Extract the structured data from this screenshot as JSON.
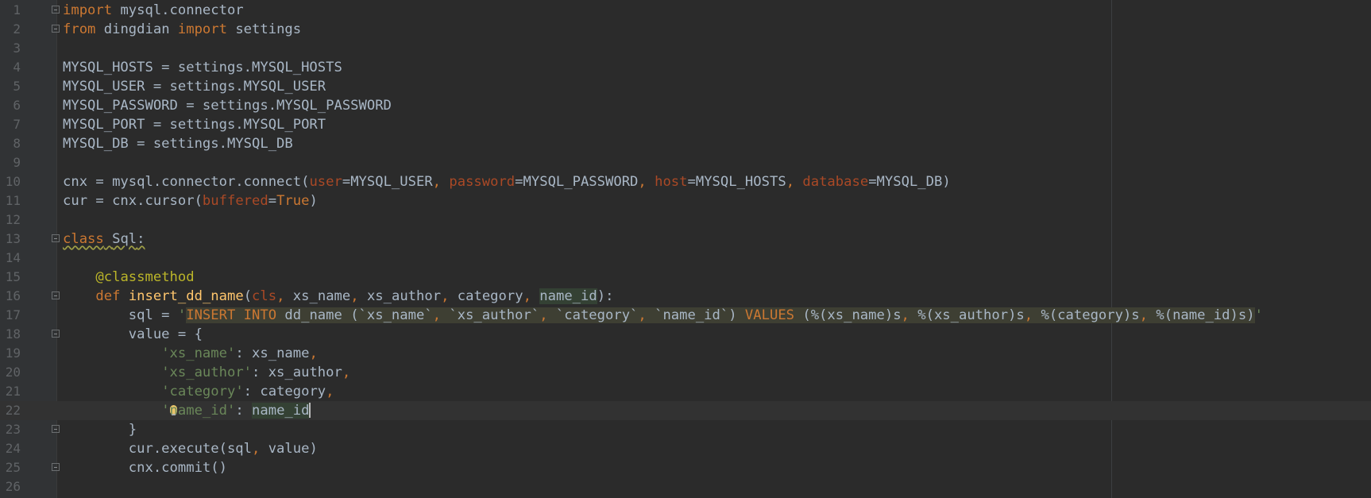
{
  "editor": {
    "lines": [
      {
        "n": "1",
        "tokens": [
          "import",
          " mysql.connector"
        ]
      },
      {
        "n": "2",
        "tokens": [
          "from",
          " dingdian ",
          "import",
          " settings"
        ]
      },
      {
        "n": "3",
        "tokens": []
      },
      {
        "n": "4",
        "tokens": [
          "MYSQL_HOSTS = settings.MYSQL_HOSTS"
        ]
      },
      {
        "n": "5",
        "tokens": [
          "MYSQL_USER = settings.MYSQL_USER"
        ]
      },
      {
        "n": "6",
        "tokens": [
          "MYSQL_PASSWORD = settings.MYSQL_PASSWORD"
        ]
      },
      {
        "n": "7",
        "tokens": [
          "MYSQL_PORT = settings.MYSQL_PORT"
        ]
      },
      {
        "n": "8",
        "tokens": [
          "MYSQL_DB = settings.MYSQL_DB"
        ]
      },
      {
        "n": "9",
        "tokens": []
      },
      {
        "n": "10",
        "tokens": [
          "cnx = mysql.connector.connect(",
          "user",
          "=MYSQL_USER",
          ", ",
          "password",
          "=MYSQL_PASSWORD",
          ", ",
          "host",
          "=MYSQL_HOSTS",
          ", ",
          "database",
          "=MYSQL_DB)"
        ]
      },
      {
        "n": "11",
        "tokens": [
          "cur = cnx.cursor(",
          "buffered",
          "=",
          "True",
          ")"
        ]
      },
      {
        "n": "12",
        "tokens": []
      },
      {
        "n": "13",
        "tokens": [
          "class",
          " ",
          "Sql",
          ":"
        ]
      },
      {
        "n": "14",
        "tokens": []
      },
      {
        "n": "15",
        "tokens": [
          "    ",
          "@classmethod"
        ]
      },
      {
        "n": "16",
        "tokens": [
          "    ",
          "def",
          " ",
          "insert_dd_name",
          "(",
          "cls",
          ", ",
          "xs_name",
          ", ",
          "xs_author",
          ", ",
          "category",
          ", ",
          "name_id",
          "):"
        ]
      },
      {
        "n": "17",
        "tokens": [
          "        sql = ",
          "'",
          "INSERT INTO",
          " dd_name (`xs_name`",
          ", ",
          "`xs_author`",
          ", ",
          "`category`",
          ", ",
          "`name_id`) ",
          "VALUES",
          " (%(xs_name)s",
          ", ",
          "%(xs_author)s",
          ", ",
          "%(category)s",
          ", ",
          "%(name_id)s)",
          "'"
        ]
      },
      {
        "n": "18",
        "tokens": [
          "        value = {"
        ]
      },
      {
        "n": "19",
        "tokens": [
          "            ",
          "'xs_name'",
          ": xs_name",
          ","
        ]
      },
      {
        "n": "20",
        "tokens": [
          "            ",
          "'xs_author'",
          ": xs_author",
          ","
        ]
      },
      {
        "n": "21",
        "tokens": [
          "            ",
          "'category'",
          ": category",
          ","
        ]
      },
      {
        "n": "22",
        "tokens": [
          "            ",
          "'name_id'",
          ": ",
          "name_id"
        ]
      },
      {
        "n": "23",
        "tokens": [
          "        }"
        ]
      },
      {
        "n": "24",
        "tokens": [
          "        cur.execute(sql",
          ", ",
          "value)"
        ]
      },
      {
        "n": "25",
        "tokens": [
          "        cnx.commit()"
        ]
      },
      {
        "n": "26",
        "tokens": []
      }
    ]
  }
}
